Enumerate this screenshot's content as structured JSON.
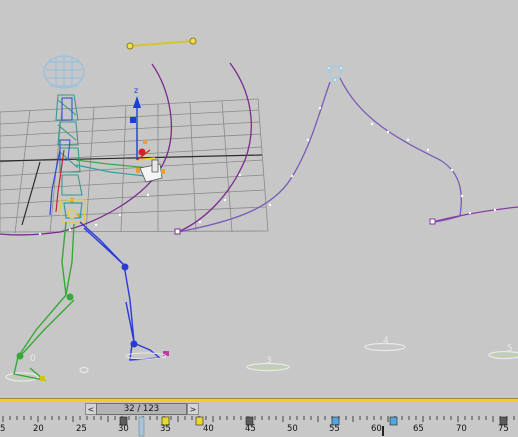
{
  "viewport": {
    "footprint_labels": [
      "0",
      "3",
      "4",
      "5"
    ],
    "axis_label": "z"
  },
  "timeline": {
    "frame_display": "32 / 123",
    "prev_arrow": "<",
    "next_arrow": ">",
    "ticks": [
      "5",
      "20",
      "25",
      "30",
      "35",
      "40",
      "45",
      "50",
      "55",
      "60",
      "65",
      "70",
      "75"
    ],
    "colors": {
      "playhead": "#f0cf27",
      "key_gray": "#5c5c5c",
      "key_yellow": "#e6da2a",
      "key_blue": "#52a6e0"
    }
  }
}
